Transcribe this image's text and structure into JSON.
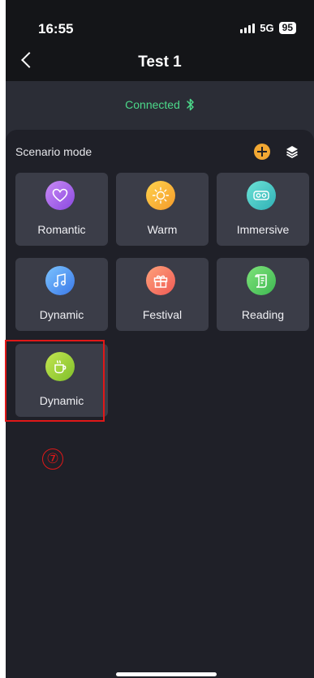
{
  "status": {
    "time": "16:55",
    "network": "5G",
    "battery": "95"
  },
  "header": {
    "title": "Test 1"
  },
  "connection": {
    "status_text": "Connected"
  },
  "scenario": {
    "section_label": "Scenario mode",
    "modes": [
      {
        "label": "Romantic",
        "icon": "heart-icon",
        "color_from": "#c98bf5",
        "color_to": "#8a48e0"
      },
      {
        "label": "Warm",
        "icon": "sun-icon",
        "color_from": "#ffd34d",
        "color_to": "#f49a2a"
      },
      {
        "label": "Immersive",
        "icon": "vr-glasses-icon",
        "color_from": "#6de3d6",
        "color_to": "#2fb0b6"
      },
      {
        "label": "Dynamic",
        "icon": "music-note-icon",
        "color_from": "#7cc4ff",
        "color_to": "#3a78e8"
      },
      {
        "label": "Festival",
        "icon": "gift-icon",
        "color_from": "#ffa27a",
        "color_to": "#ef5a55"
      },
      {
        "label": "Reading",
        "icon": "scroll-icon",
        "color_from": "#7ee37a",
        "color_to": "#3eb852"
      },
      {
        "label": "Dynamic",
        "icon": "coffee-cup-icon",
        "color_from": "#c4e651",
        "color_to": "#7fbf2a"
      }
    ]
  },
  "annotation": {
    "marker": "⑦",
    "color": "#e01818"
  }
}
